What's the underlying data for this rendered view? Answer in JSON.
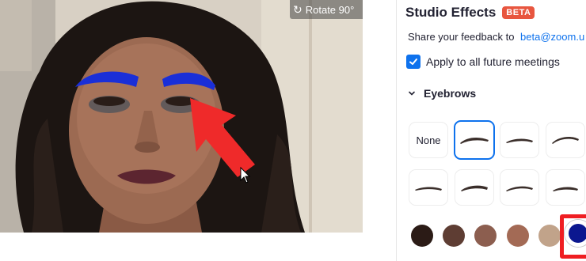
{
  "video": {
    "rotate_label": "Rotate 90°"
  },
  "panel": {
    "title": "Studio Effects",
    "badge": "BETA",
    "feedback_text": "Share your feedback to",
    "feedback_email": "beta@zoom.u",
    "apply_all_label": "Apply to all future meetings",
    "apply_all_checked": true,
    "section_label": "Eyebrows",
    "none_label": "None",
    "selected_style_index": 1
  },
  "colors": {
    "accent": "#0e72ed",
    "badge": "#e8563f",
    "eyebrow_effect": "#1a2fd8",
    "highlight": "#ef1e22",
    "swatches": [
      "#2b1b16",
      "#5e3d33",
      "#8c5e4f",
      "#a36a55",
      "#c1a38a",
      "#0b178f"
    ]
  },
  "annotations": {
    "arrow_color": "#ef2a2a"
  }
}
